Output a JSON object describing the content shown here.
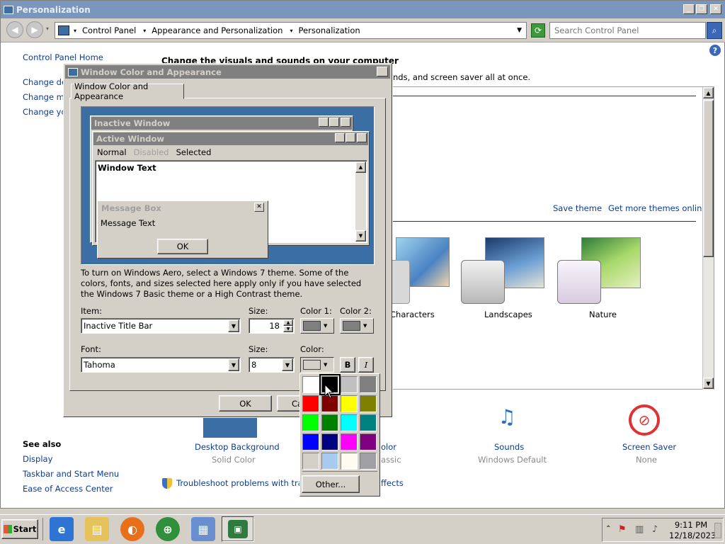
{
  "window": {
    "title": "Personalization"
  },
  "address": {
    "crumbs": [
      "Control Panel",
      "Appearance and Personalization",
      "Personalization"
    ],
    "search_placeholder": "Search Control Panel"
  },
  "sidebar": {
    "home": "Control Panel Home",
    "links": [
      "Change des",
      "Change mou",
      "Change you"
    ],
    "see_also_heading": "See also",
    "see_also": [
      "Display",
      "Taskbar and Start Menu",
      "Ease of Access Center"
    ]
  },
  "content": {
    "heading": "Change the visuals and sounds on your computer",
    "subtext": "nds, and screen saver all at once.",
    "save_theme": "Save theme",
    "more_themes": "Get more themes online",
    "themes": [
      "Characters",
      "Landscapes",
      "Nature"
    ],
    "bottom": [
      {
        "label": "Desktop Background",
        "sub": "Solid Color"
      },
      {
        "label": "olor",
        "sub": "assic"
      },
      {
        "label": "Sounds",
        "sub": "Windows Default"
      },
      {
        "label": "Screen Saver",
        "sub": "None"
      }
    ],
    "troubleshoot": "Troubleshoot problems with transpar",
    "troubleshoot_tail": "ffects"
  },
  "dialog": {
    "title": "Window Color and Appearance",
    "tab": "Window Color and Appearance",
    "preview": {
      "inactive": "Inactive Window",
      "active": "Active Window",
      "menu": [
        "Normal",
        "Disabled",
        "Selected"
      ],
      "window_text": "Window Text",
      "msg_title": "Message Box",
      "msg_text": "Message Text",
      "ok": "OK"
    },
    "info": "To turn on Windows Aero, select a Windows 7 theme.  Some of the colors, fonts, and sizes selected here apply only if you have selected the Windows 7 Basic theme or a High Contrast theme.",
    "item_label": "Item:",
    "item_value": "Inactive Title Bar",
    "size_label": "Size:",
    "size_value": "18",
    "color1_label": "Color 1:",
    "color2_label": "Color 2:",
    "font_label": "Font:",
    "font_value": "Tahoma",
    "font_size_label": "Size:",
    "font_size_value": "8",
    "color_label": "Color:",
    "bold": "B",
    "italic": "I",
    "ok": "OK",
    "cancel": "Ca"
  },
  "palette": {
    "colors": [
      "#ffffff",
      "#000000",
      "#c0c0c0",
      "#808080",
      "#ff0000",
      "#800000",
      "#ffff00",
      "#808000",
      "#00ff00",
      "#008000",
      "#00ffff",
      "#008080",
      "#0000ff",
      "#000080",
      "#ff00ff",
      "#800080",
      "#d4d0c8",
      "#a6caf0",
      "#fffbf0",
      "#a0a0a4"
    ],
    "other": "Other..."
  },
  "taskbar": {
    "start": "Start",
    "time": "9:11 PM",
    "date": "12/18/2023"
  }
}
